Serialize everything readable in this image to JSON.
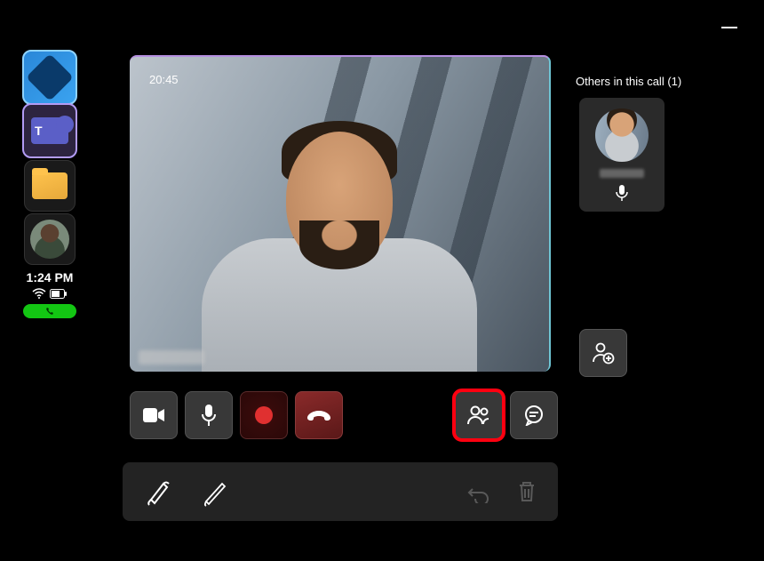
{
  "window": {
    "minimize": "—"
  },
  "sidebar": {
    "tiles": [
      {
        "name": "copilot"
      },
      {
        "name": "teams",
        "letter": "T"
      },
      {
        "name": "files"
      },
      {
        "name": "contact"
      }
    ],
    "clock": "1:24 PM",
    "call_active": true
  },
  "call": {
    "duration": "20:45",
    "participant_name": ""
  },
  "others": {
    "label": "Others in this call (1)",
    "count": 1,
    "participants": [
      {
        "name": "",
        "muted": false
      }
    ]
  },
  "controls": {
    "camera": "Camera",
    "mic": "Microphone",
    "record": "Record",
    "hangup": "Hang up",
    "people": "People",
    "chat": "Chat",
    "add_people": "Add people"
  },
  "tray": {
    "marker": "Marker",
    "pen": "Pen",
    "undo": "Undo",
    "delete": "Delete"
  }
}
